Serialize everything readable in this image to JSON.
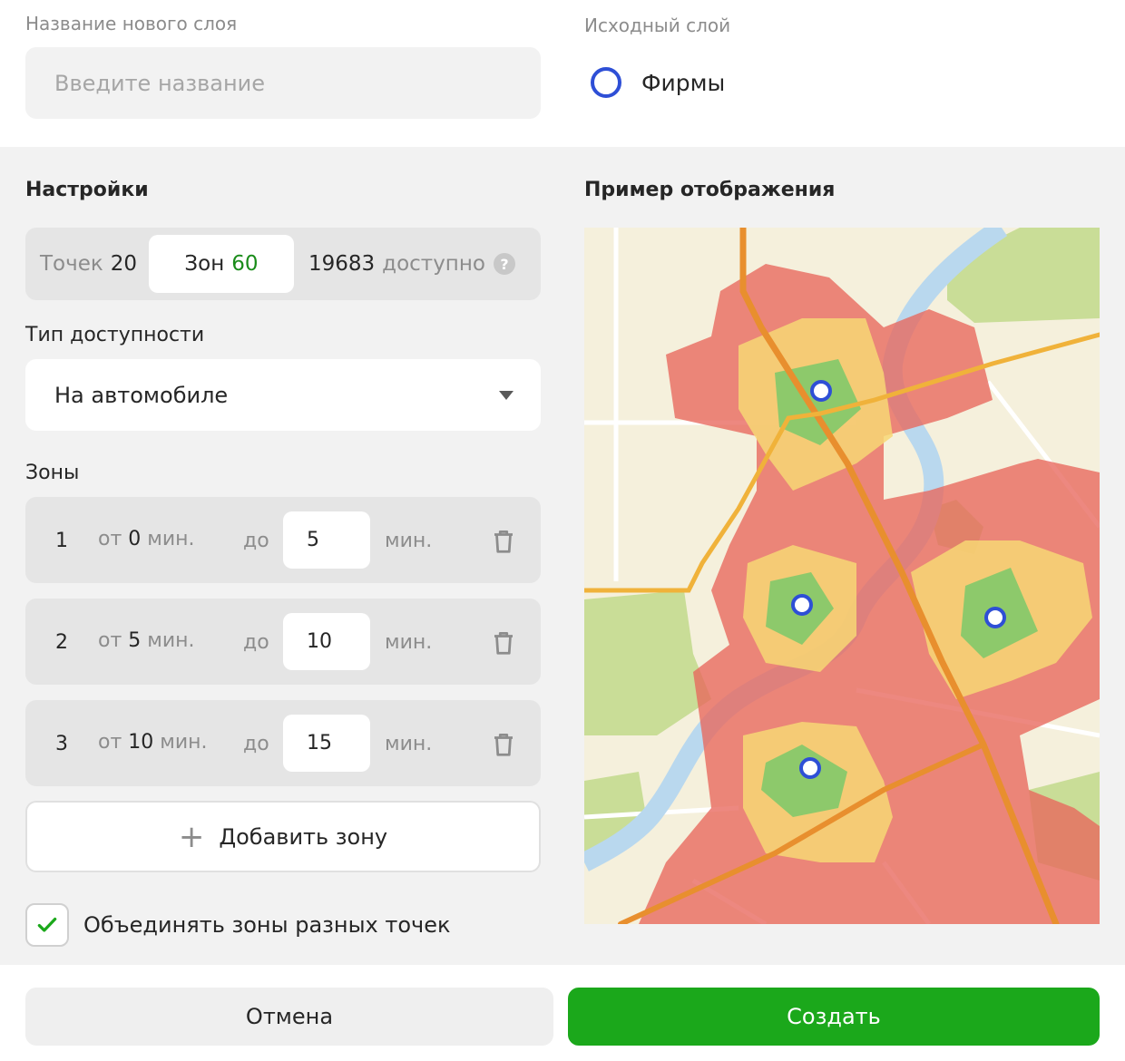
{
  "new_layer": {
    "label": "Название нового слоя",
    "placeholder": "Введите название",
    "value": ""
  },
  "source_layer": {
    "label": "Исходный слой",
    "name": "Фирмы",
    "color": "#2e4fd6"
  },
  "settings": {
    "title": "Настройки",
    "stats": {
      "points_label": "Точек",
      "points_value": "20",
      "zones_label": "Зон",
      "zones_value": "60",
      "available_value": "19683",
      "available_label": "доступно",
      "help_icon": "question-circle-icon"
    },
    "accessibility": {
      "label": "Тип доступности",
      "selected": "На автомобиле",
      "icon": "caret-down-icon"
    },
    "zones": {
      "label": "Зоны",
      "from_word": "от",
      "to_word": "до",
      "unit": "мин.",
      "items": [
        {
          "num": "1",
          "from": "0",
          "to": "5"
        },
        {
          "num": "2",
          "from": "5",
          "to": "10"
        },
        {
          "num": "3",
          "from": "10",
          "to": "15"
        }
      ],
      "delete_icon": "trash-icon",
      "add_label": "Добавить зону",
      "add_icon": "plus-icon"
    },
    "merge": {
      "label": "Объединять зоны разных точек",
      "checked": true,
      "check_color": "#1ba81b"
    }
  },
  "preview": {
    "title": "Пример отображения"
  },
  "actions": {
    "cancel": "Отмена",
    "create": "Создать",
    "create_color": "#1ba81b"
  }
}
